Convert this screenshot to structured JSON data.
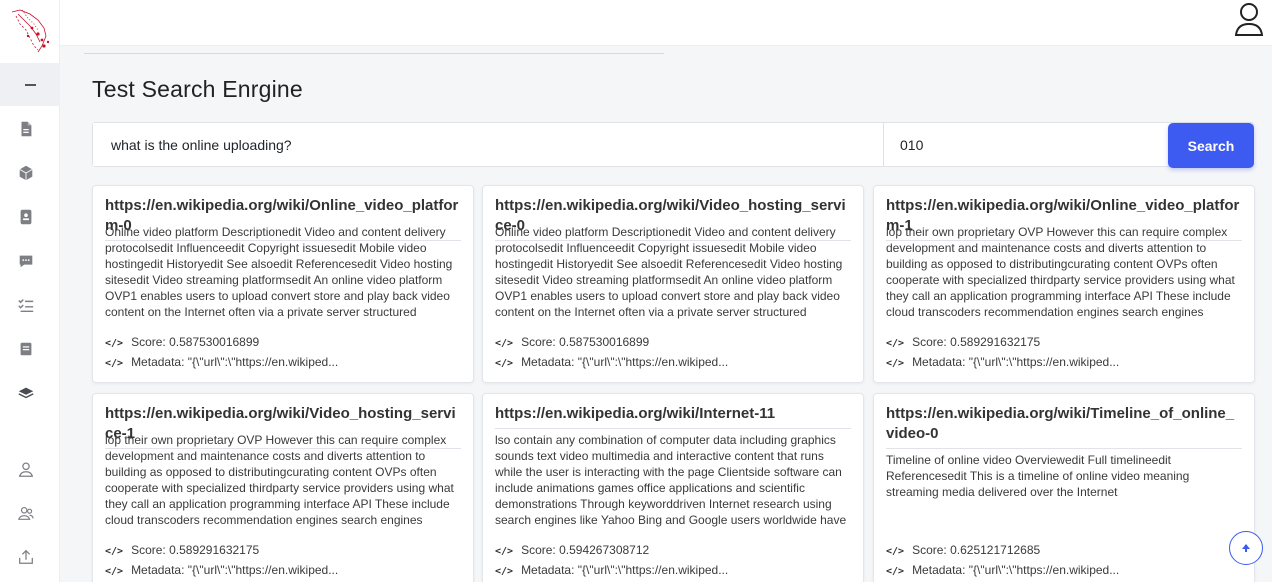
{
  "page": {
    "title": "Test Search Enrgine"
  },
  "search": {
    "query": "what is the online uploading?",
    "count": "010",
    "button_label": "Search"
  },
  "score_label": "Score:",
  "metadata_label": "Metadata:",
  "results": [
    {
      "title": "https://en.wikipedia.org/wiki/Online_video_platform-0",
      "body": "Online video platform Descriptionedit Video and content delivery protocolsedit Influenceedit Copyright issuesedit Mobile video hostingedit Historyedit See alsoedit Referencesedit Video hosting sitesedit Video streaming platformsedit An online video platform OVP1 enables users to upload convert store and play back video content on the Internet often via a private server structured largescale system that may generate revenue Users will generally",
      "score": "0.587530016899",
      "metadata": "\"{\\\"url\\\":\\\"https://en.wikiped..."
    },
    {
      "title": "https://en.wikipedia.org/wiki/Video_hosting_service-0",
      "body": "Online video platform Descriptionedit Video and content delivery protocolsedit Influenceedit Copyright issuesedit Mobile video hostingedit Historyedit See alsoedit Referencesedit Video hosting sitesedit Video streaming platformsedit An online video platform OVP1 enables users to upload convert store and play back video content on the Internet often via a private server structured largescale system that may generate revenue Users will generally",
      "score": "0.587530016899",
      "metadata": "\"{\\\"url\\\":\\\"https://en.wikiped..."
    },
    {
      "title": "https://en.wikipedia.org/wiki/Online_video_platform-1",
      "body": "lop their own proprietary OVP However this can require complex development and maintenance costs and diverts attention to building as opposed to distributingcurating content OVPs often cooperate with specialized thirdparty service providers using what they call an application programming interface API These include cloud transcoders recommendation engines search engines metadata libraries and analytics providers The vast majority of",
      "score": "0.589291632175",
      "metadata": "\"{\\\"url\\\":\\\"https://en.wikiped..."
    },
    {
      "title": "https://en.wikipedia.org/wiki/Video_hosting_service-1",
      "body": "lop their own proprietary OVP However this can require complex development and maintenance costs and diverts attention to building as opposed to distributingcurating content OVPs often cooperate with specialized thirdparty service providers using what they call an application programming interface API These include cloud transcoders recommendation engines search engines metadata libraries and analytics providers The vast majority of",
      "score": "0.589291632175",
      "metadata": "\"{\\\"url\\\":\\\"https://en.wikiped..."
    },
    {
      "title": "https://en.wikipedia.org/wiki/Internet-11",
      "body": "lso contain any combination of computer data including graphics sounds text video multimedia and interactive content that runs while the user is interacting with the page Clientside software can include animations games office applications and scientific demonstrations Through keyworddriven Internet research using search engines like Yahoo Bing and Google users worldwide have easy instant access to a vast and diverse amount of online",
      "score": "0.594267308712",
      "metadata": "\"{\\\"url\\\":\\\"https://en.wikiped..."
    },
    {
      "title": "https://en.wikipedia.org/wiki/Timeline_of_online_video-0",
      "body": "Timeline of online video Overviewedit Full timelineedit Referencesedit This is a timeline of online video meaning streaming media delivered over the Internet",
      "score": "0.625121712685",
      "metadata": "\"{\\\"url\\\":\\\"https://en.wikiped..."
    }
  ],
  "sidebar": {
    "icons": [
      "document-icon",
      "cube-icon",
      "contact-card-icon",
      "chat-icon",
      "checklist-icon",
      "notes-icon",
      "layers-icon",
      "user-icon",
      "users-icon",
      "upload-icon"
    ]
  },
  "colors": {
    "accent": "#3d5af1",
    "logo": "#c8102e"
  }
}
